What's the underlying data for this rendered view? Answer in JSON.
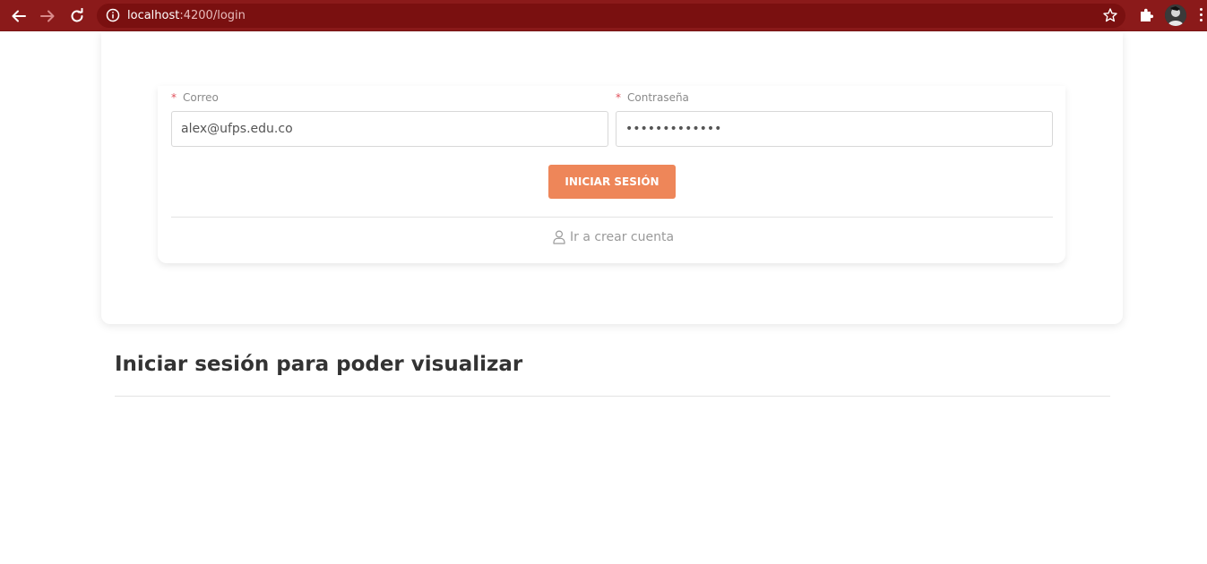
{
  "browser": {
    "url_host": "localhost",
    "url_path": ":4200/login",
    "toolbar_color": "#8b1a1a"
  },
  "login_form": {
    "email_label": "Correo",
    "email_required_mark": "*",
    "email_value": "alex@ufps.edu.co",
    "password_label": "Contraseña",
    "password_required_mark": "*",
    "password_value": "•••••••••••••",
    "submit_label": "INICIAR SESIÓN",
    "create_account_label": "Ir a crear cuenta",
    "accent_color": "#ee8659"
  },
  "main": {
    "heading": "Iniciar sesión para poder visualizar"
  },
  "icons": {
    "back": "arrow-left-icon",
    "forward": "arrow-right-icon",
    "reload": "reload-icon",
    "site_info": "info-icon",
    "bookmark": "star-icon",
    "extensions": "puzzle-icon",
    "profile": "avatar",
    "menu": "kebab-menu-icon",
    "create_account": "user-icon"
  }
}
